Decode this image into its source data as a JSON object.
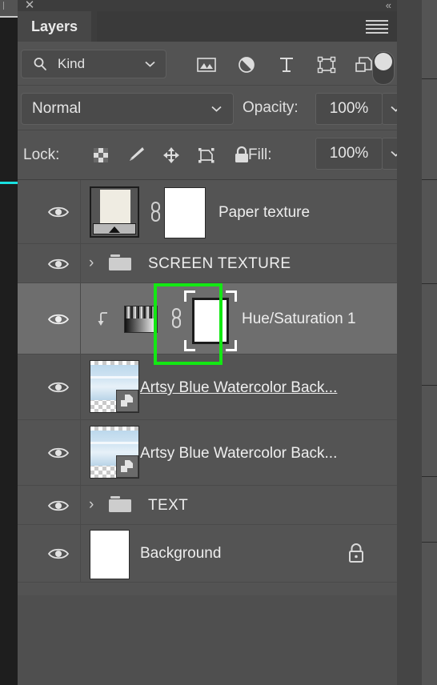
{
  "panel": {
    "title": "Layers",
    "close_icon": "close-icon",
    "collapse_icon": "collapse-panel-icon",
    "menu_icon": "panel-menu-icon"
  },
  "filter": {
    "search_icon": "search-icon",
    "kind_label": "Kind",
    "kind_chevron": "chevron-down-icon",
    "type_filters": [
      {
        "name": "filter-pixel-layers",
        "icon": "image-icon"
      },
      {
        "name": "filter-adjustment-layers",
        "icon": "adjustment-half-circle-icon"
      },
      {
        "name": "filter-type-layers",
        "icon": "type-t-icon"
      },
      {
        "name": "filter-shape-layers",
        "icon": "shape-bounding-box-icon"
      },
      {
        "name": "filter-smart-objects",
        "icon": "smart-object-icon"
      }
    ],
    "toggle_name": "filter-enable-toggle"
  },
  "blend": {
    "mode": "Normal",
    "mode_chevron": "chevron-down-icon",
    "opacity_label": "Opacity:",
    "opacity_value": "100%",
    "opacity_chevron": "chevron-down-icon"
  },
  "lock": {
    "label": "Lock:",
    "icons": [
      {
        "name": "lock-transparent-pixels-icon",
        "icon": "checkerboard-icon"
      },
      {
        "name": "lock-image-pixels-icon",
        "icon": "brush-icon"
      },
      {
        "name": "lock-position-icon",
        "icon": "move-arrows-icon"
      },
      {
        "name": "lock-artboard-nesting-icon",
        "icon": "artboard-icon"
      },
      {
        "name": "lock-all-icon",
        "icon": "padlock-icon"
      }
    ],
    "fill_label": "Fill:",
    "fill_value": "100%",
    "fill_chevron": "chevron-down-icon"
  },
  "layers": [
    {
      "name": "Paper texture",
      "type": "smart-object-with-mask",
      "visible": true,
      "selected": false,
      "has_link_icon": true,
      "has_mask": true
    },
    {
      "name": "SCREEN TEXTURE",
      "type": "group",
      "visible": true,
      "selected": false,
      "expanded": false
    },
    {
      "name": "Hue/Saturation 1",
      "type": "adjustment",
      "visible": true,
      "selected": true,
      "clipped": true,
      "has_link_icon": true,
      "has_mask": true,
      "mask_active": true
    },
    {
      "name": "Artsy Blue Watercolor Back...",
      "type": "smart-object",
      "visible": true,
      "selected": false,
      "underlined": true
    },
    {
      "name": "Artsy Blue Watercolor Back...",
      "type": "smart-object",
      "visible": true,
      "selected": false,
      "underlined": false
    },
    {
      "name": "TEXT",
      "type": "group",
      "visible": true,
      "selected": false,
      "expanded": false
    },
    {
      "name": "Background",
      "type": "locked-background",
      "visible": true,
      "selected": false,
      "locked": true
    }
  ],
  "annotation": {
    "name": "layer-mask-highlight-box",
    "color": "#13e813",
    "targets": "Hue/Saturation 1 layer mask thumbnail"
  },
  "colors": {
    "panel_bg": "#535353",
    "row_bg": "#545454",
    "row_selected_bg": "#6e6e6e",
    "tab_bg": "#474747",
    "titlebar_bg": "#3d3d3d",
    "text": "#eeeeee",
    "guide_cyan": "#19e0e0"
  }
}
